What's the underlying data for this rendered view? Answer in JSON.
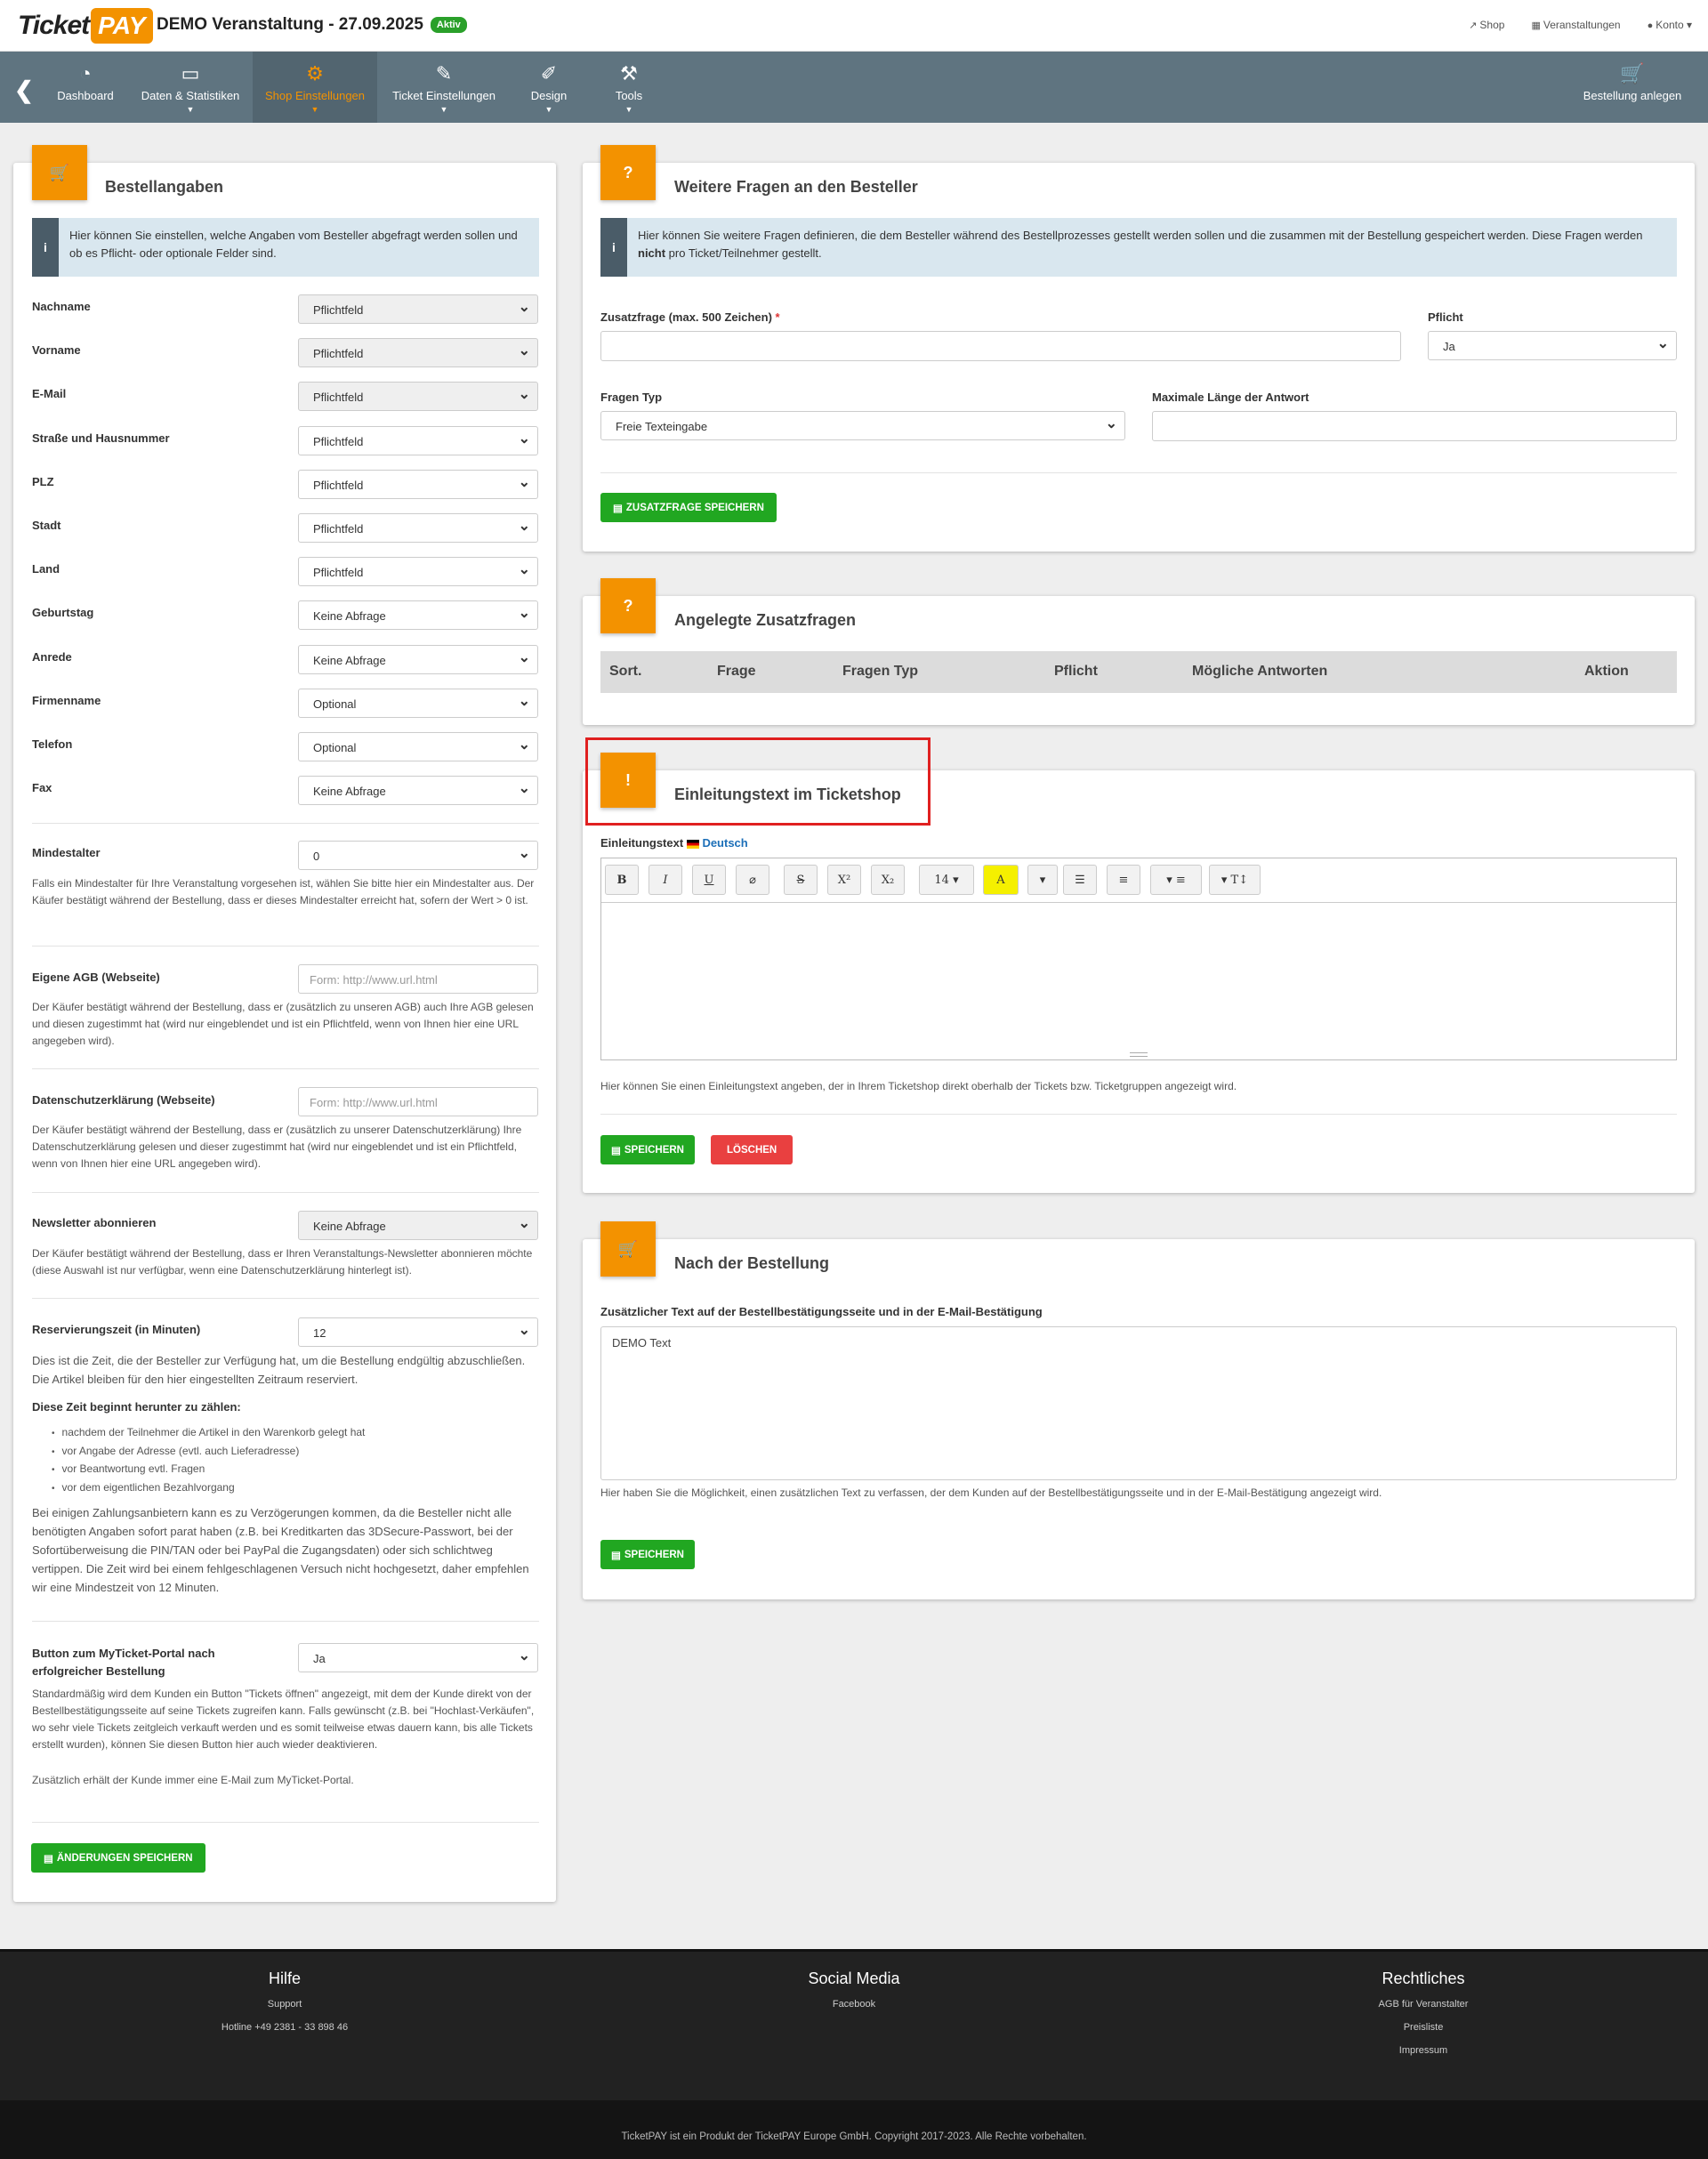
{
  "header": {
    "logo_ticket": "Ticket",
    "logo_pay": "PAY",
    "event_title": "DEMO Veranstaltung - 27.09.2025",
    "status_badge": "Aktiv",
    "links": {
      "shop": "Shop",
      "events": "Veranstaltungen",
      "account": "Konto"
    }
  },
  "nav": {
    "items": [
      {
        "label": "Dashboard",
        "icon": "gauge-icon"
      },
      {
        "label": "Daten & Statistiken",
        "icon": "bar-chart-icon"
      },
      {
        "label": "Shop Einstellungen",
        "icon": "gear-icon"
      },
      {
        "label": "Ticket Einstellungen",
        "icon": "ticket-icon"
      },
      {
        "label": "Design",
        "icon": "brush-icon"
      },
      {
        "label": "Tools",
        "icon": "wrench-icon"
      }
    ],
    "active": "Shop Einstellungen",
    "create_order": "Bestellung anlegen"
  },
  "order_card": {
    "title": "Bestellangaben",
    "info": "Hier können Sie einstellen, welche Angaben vom Besteller abgefragt werden sollen und ob es Pflicht- oder optionale Felder sind.",
    "fields": [
      {
        "label": "Nachname",
        "value": "Pflichtfeld"
      },
      {
        "label": "Vorname",
        "value": "Pflichtfeld"
      },
      {
        "label": "E-Mail",
        "value": "Pflichtfeld"
      },
      {
        "label": "Straße und Hausnummer",
        "value": "Pflichtfeld"
      },
      {
        "label": "PLZ",
        "value": "Pflichtfeld"
      },
      {
        "label": "Stadt",
        "value": "Pflichtfeld"
      },
      {
        "label": "Land",
        "value": "Pflichtfeld"
      },
      {
        "label": "Geburtstag",
        "value": "Keine Abfrage"
      },
      {
        "label": "Anrede",
        "value": "Keine Abfrage"
      },
      {
        "label": "Firmenname",
        "value": "Optional"
      },
      {
        "label": "Telefon",
        "value": "Optional"
      },
      {
        "label": "Fax",
        "value": "Keine Abfrage"
      }
    ],
    "min_age": {
      "label": "Mindestalter",
      "value": "0",
      "help": "Falls ein Mindestalter für Ihre Veranstaltung vorgesehen ist, wählen Sie bitte hier ein Mindestalter aus. Der Käufer bestätigt während der Bestellung, dass er dieses Mindestalter erreicht hat, sofern der Wert > 0 ist."
    },
    "agb": {
      "label": "Eigene AGB (Webseite)",
      "placeholder": "Form: http://www.url.html",
      "help": "Der Käufer bestätigt während der Bestellung, dass er (zusätzlich zu unseren AGB) auch Ihre AGB gelesen und diesen zugestimmt hat (wird nur eingeblendet und ist ein Pflichtfeld, wenn von Ihnen hier eine URL angegeben wird)."
    },
    "privacy": {
      "label": "Datenschutzerklärung (Webseite)",
      "placeholder": "Form: http://www.url.html",
      "help": "Der Käufer bestätigt während der Bestellung, dass er (zusätzlich zu unserer Datenschutzerklärung) Ihre Datenschutzerklärung gelesen und dieser zugestimmt hat (wird nur eingeblendet und ist ein Pflichtfeld, wenn von Ihnen hier eine URL angegeben wird)."
    },
    "newsletter": {
      "label": "Newsletter abonnieren",
      "value": "Keine Abfrage",
      "help": "Der Käufer bestätigt während der Bestellung, dass er Ihren Veranstaltungs-Newsletter abonnieren möchte (diese Auswahl ist nur verfügbar, wenn eine Datenschutzerklärung hinterlegt ist)."
    },
    "reservation": {
      "label": "Reservierungszeit (in Minuten)",
      "value": "12",
      "help1": "Dies ist die Zeit, die der Besteller zur Verfügung hat, um die Bestellung endgültig abzuschließen. Die Artikel bleiben für den hier eingestellten Zeitraum reserviert.",
      "subheading": "Diese Zeit beginnt herunter zu zählen:",
      "bullets": [
        "nachdem der Teilnehmer die Artikel in den Warenkorb gelegt hat",
        "vor Angabe der Adresse (evtl. auch Lieferadresse)",
        "vor Beantwortung evtl. Fragen",
        "vor dem eigentlichen Bezahlvorgang"
      ],
      "help2": "Bei einigen Zahlungsanbietern kann es zu Verzögerungen kommen, da die Besteller nicht alle benötigten Angaben sofort parat haben (z.B. bei Kreditkarten das 3DSecure-Passwort, bei der Sofortüberweisung die PIN/TAN oder bei PayPal die Zugangsdaten) oder sich schlichtweg vertippen. Die Zeit wird bei einem fehlgeschlagenen Versuch nicht hochgesetzt, daher empfehlen wir eine Mindestzeit von 12 Minuten."
    },
    "myticket": {
      "label": "Button zum MyTicket-Portal nach erfolgreicher Bestellung",
      "value": "Ja",
      "help": "Standardmäßig wird dem Kunden ein Button \"Tickets öffnen\" angezeigt, mit dem der Kunde direkt von der Bestellbestätigungsseite auf seine Tickets zugreifen kann. Falls gewünscht (z.B. bei \"Hochlast-Verkäufen\", wo sehr viele Tickets zeitgleich verkauft werden und es somit teilweise etwas dauern kann, bis alle Tickets erstellt wurden), können Sie diesen Button hier auch wieder deaktivieren.",
      "help_extra": "Zusätzlich erhält der Kunde immer eine E-Mail zum MyTicket-Portal."
    },
    "save_button": "ÄNDERUNGEN SPEICHERN"
  },
  "questions_card": {
    "title": "Weitere Fragen an den Besteller",
    "info_a": "Hier können Sie weitere Fragen definieren, die dem Besteller während des Bestellprozesses gestellt werden sollen und die zusammen mit der Bestellung gespeichert werden. Diese Fragen werden ",
    "info_bold": "nicht",
    "info_b": " pro Ticket/Teilnehmer gestellt.",
    "question_label": "Zusatzfrage (max. 500 Zeichen)",
    "required_mark": "*",
    "required_label": "Pflicht",
    "required_value": "Ja",
    "type_label": "Fragen Typ",
    "type_value": "Freie Texteingabe",
    "maxlen_label": "Maximale Länge der Antwort",
    "save_button": "ZUSATZFRAGE SPEICHERN"
  },
  "existing_card": {
    "title": "Angelegte Zusatzfragen",
    "columns": [
      "Sort.",
      "Frage",
      "Fragen Typ",
      "Pflicht",
      "Mögliche Antworten",
      "Aktion"
    ]
  },
  "intro_card": {
    "title": "Einleitungstext im Ticketshop",
    "field_label": "Einleitungstext",
    "language": "Deutsch",
    "toolbar": [
      "B",
      "I",
      "U",
      "⌀",
      "S",
      "X²",
      "X₂",
      "14 ▾",
      "A",
      "▾",
      "☰",
      "≡",
      "▾ ≡",
      "▾ T↕"
    ],
    "help": "Hier können Sie einen Einleitungstext angeben, der in Ihrem Ticketshop direkt oberhalb der Tickets bzw. Ticketgruppen angezeigt wird.",
    "save_button": "SPEICHERN",
    "delete_button": "LÖSCHEN"
  },
  "after_card": {
    "title": "Nach der Bestellung",
    "field_label": "Zusätzlicher Text auf der Bestellbestätigungsseite und in der E-Mail-Bestätigung",
    "text_value": "DEMO Text",
    "help": "Hier haben Sie die Möglichkeit, einen zusätzlichen Text zu verfassen, der dem Kunden auf der Bestellbestätigungsseite und in der E-Mail-Bestätigung angezeigt wird.",
    "save_button": "SPEICHERN"
  },
  "footer": {
    "help": {
      "title": "Hilfe",
      "links": [
        "Support",
        "Hotline +49 2381 - 33 898 46"
      ]
    },
    "social": {
      "title": "Social Media",
      "links": [
        "Facebook"
      ]
    },
    "legal": {
      "title": "Rechtliches",
      "links": [
        "AGB für Veranstalter",
        "Preisliste",
        "Impressum"
      ]
    },
    "copyright": "TicketPAY ist ein Produkt der TicketPAY Europe GmbH. Copyright 2017-2023. Alle Rechte vorbehalten."
  },
  "colors": {
    "accent": "#f39200",
    "nav": "#5f7480",
    "success": "#21a721",
    "danger": "#e94040"
  }
}
